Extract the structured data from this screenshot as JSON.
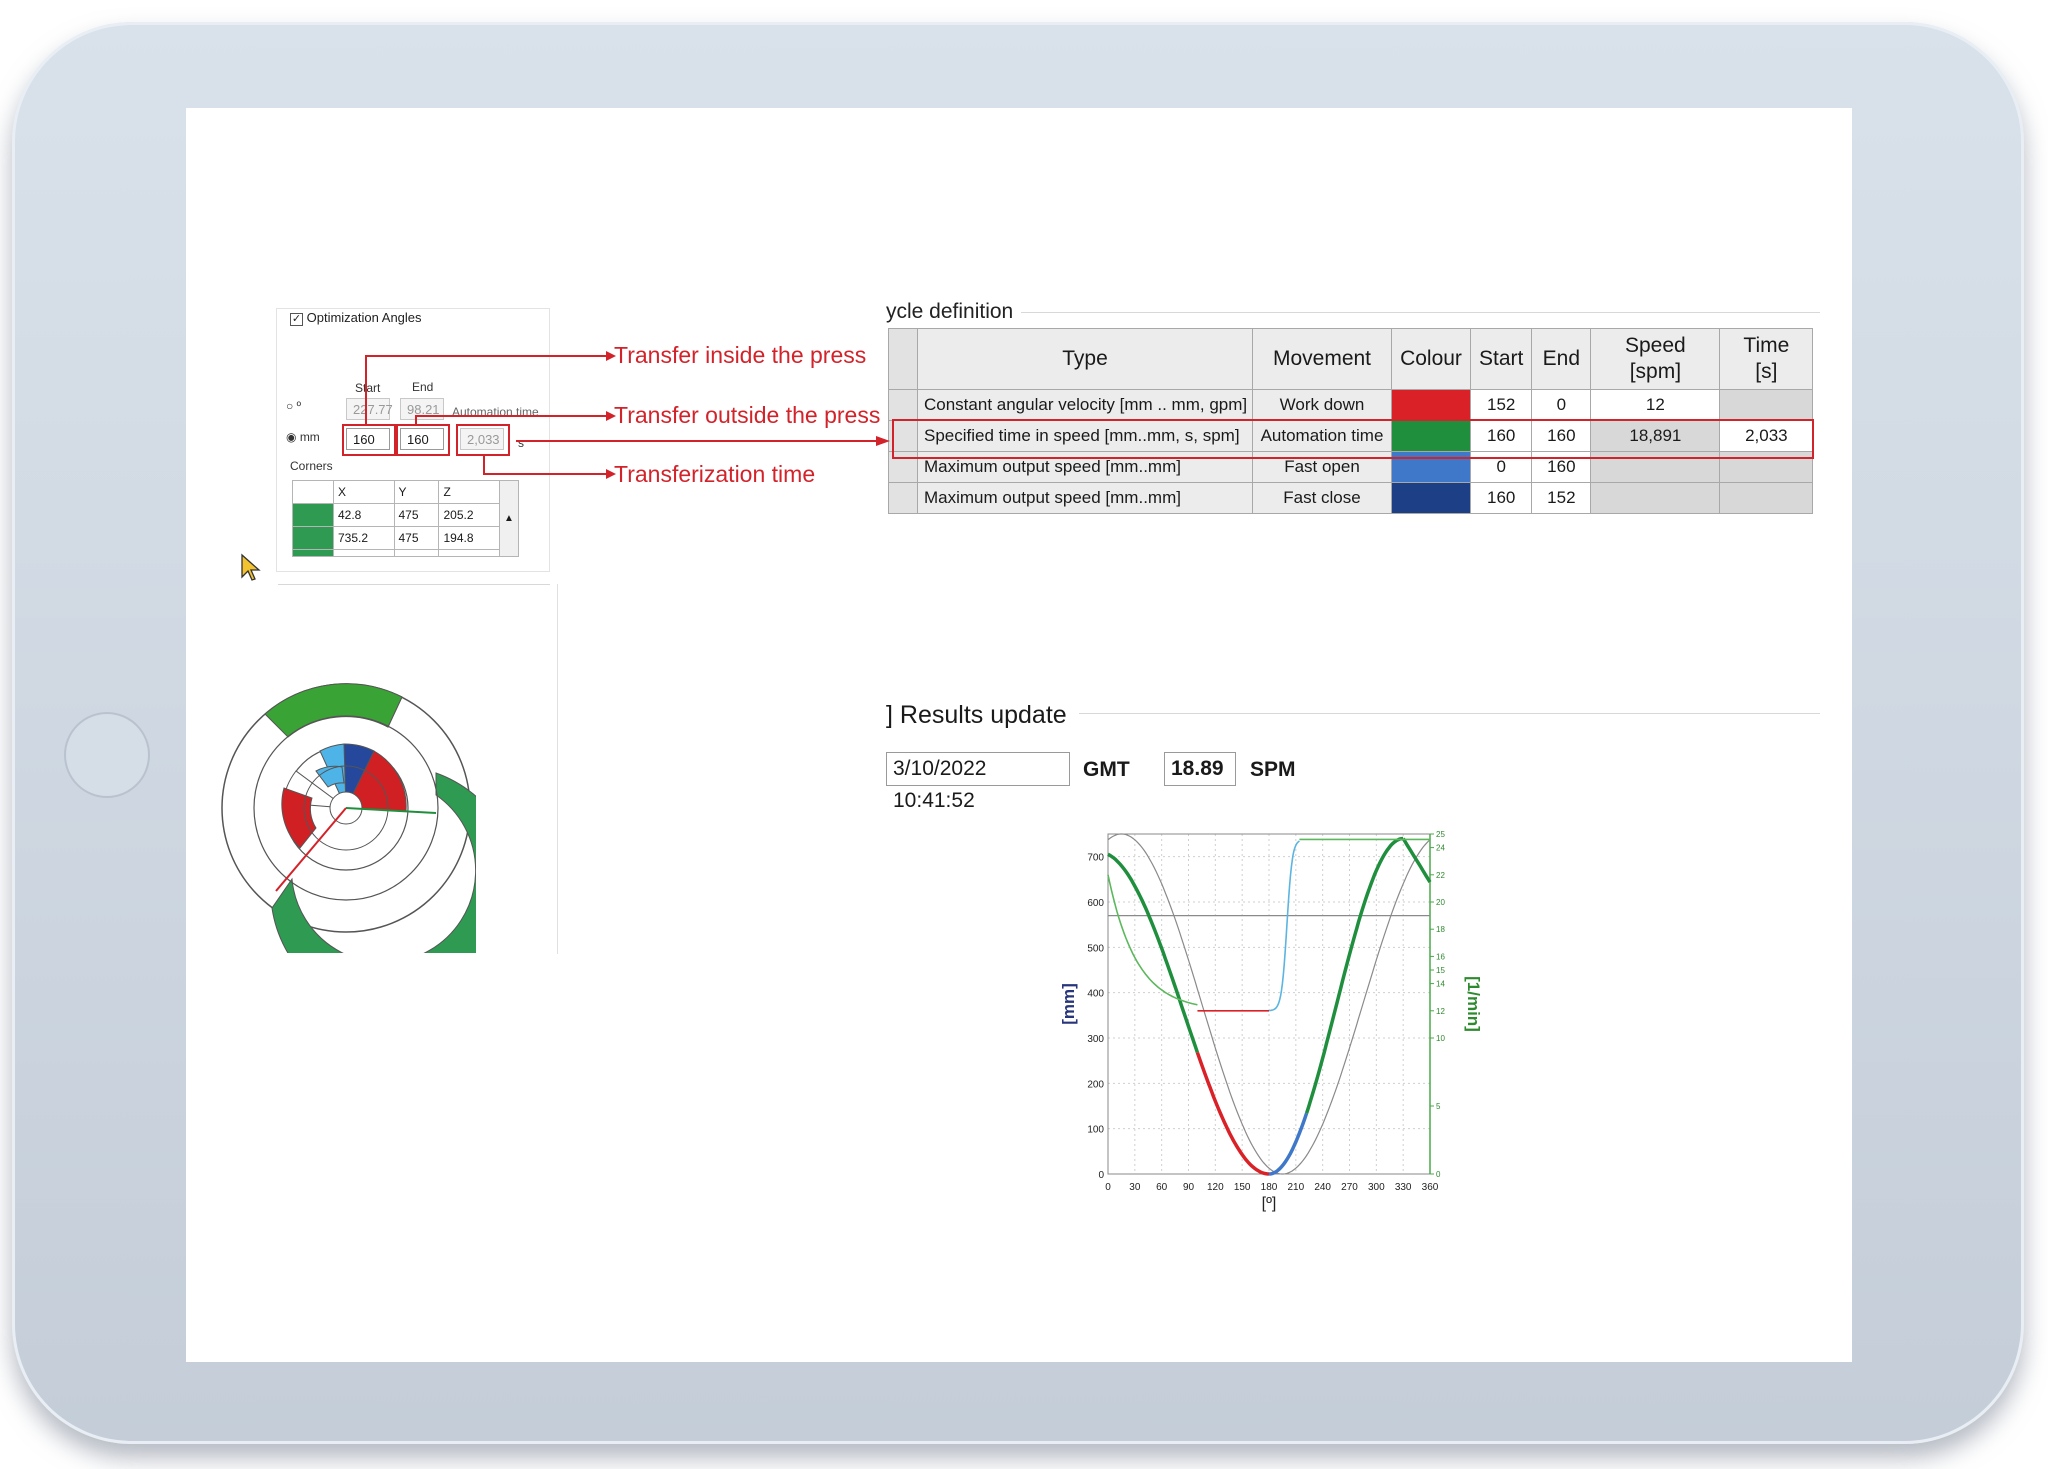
{
  "left_panel": {
    "checkbox_label": "Optimization Angles",
    "start_header": "Start",
    "end_header": "End",
    "automation_time_header": "Automation time",
    "deg_unit": "º",
    "mm_unit": "mm",
    "deg_start": "227.77",
    "deg_end": "98.21",
    "mm_start": "160",
    "mm_end": "160",
    "automation_time_value": "2,033",
    "seconds_unit": "s",
    "corners_label": "Corners",
    "corners_headers": [
      "X",
      "Y",
      "Z"
    ],
    "corners_rows": [
      {
        "x": "42.8",
        "y": "475",
        "z": "205.2"
      },
      {
        "x": "735.2",
        "y": "475",
        "z": "194.8"
      }
    ]
  },
  "annotations": {
    "inside": "Transfer inside the press",
    "outside": "Transfer outside the press",
    "time": "Transferization time"
  },
  "cycle": {
    "title": "ycle definition",
    "headers": {
      "type": "Type",
      "movement": "Movement",
      "colour": "Colour",
      "start": "Start",
      "end": "End",
      "speed": "Speed",
      "speed_unit": "[spm]",
      "time": "Time",
      "time_unit": "[s]"
    },
    "rows": [
      {
        "type": "Constant angular velocity [mm .. mm, gpm]",
        "movement": "Work down",
        "colour": "#d92127",
        "start": "152",
        "end": "0",
        "speed": "12",
        "time": ""
      },
      {
        "type": "Specified time in speed [mm..mm, s, spm]",
        "movement": "Automation time",
        "colour": "#1f8f3e",
        "start": "160",
        "end": "160",
        "speed": "18,891",
        "time": "2,033"
      },
      {
        "type": "Maximum output speed [mm..mm]",
        "movement": "Fast open",
        "colour": "#3f78c9",
        "start": "0",
        "end": "160",
        "speed": "",
        "time": ""
      },
      {
        "type": "Maximum output speed [mm..mm]",
        "movement": "Fast close",
        "colour": "#1c3f85",
        "start": "160",
        "end": "152",
        "speed": "",
        "time": ""
      }
    ]
  },
  "results": {
    "title": "Results update",
    "timestamp": "3/10/2022 10:41:52",
    "tz": "GMT",
    "spm_value": "18.89",
    "spm_label": "SPM"
  },
  "chart_data": {
    "type": "line",
    "xlabel": "[º]",
    "ylabel_left": "[mm]",
    "ylabel_right": "[1/min]",
    "x_ticks": [
      "0",
      "30",
      "60",
      "90",
      "120",
      "150",
      "180",
      "210",
      "240",
      "270",
      "300",
      "330",
      "360"
    ],
    "y_left_ticks": [
      "0",
      "100",
      "200",
      "300",
      "400",
      "500",
      "600",
      "700"
    ],
    "y_right_ticks": [
      "0",
      "5",
      "10",
      "12",
      "14",
      "15",
      "16",
      "18",
      "20",
      "22",
      "24",
      "25"
    ],
    "xlim": [
      0,
      360
    ],
    "ylim_left": [
      0,
      750
    ],
    "ylim_right": [
      0,
      25
    ],
    "grid": true,
    "colors": {
      "work_down": "#d92127",
      "automation": "#1f8f3e",
      "fast_open": "#3f78c9",
      "fast_close": "#1c3f85",
      "gray": "#8a8a8a",
      "speed_light_green": "#5cb85c",
      "speed_blue": "#5bb5e0"
    }
  }
}
